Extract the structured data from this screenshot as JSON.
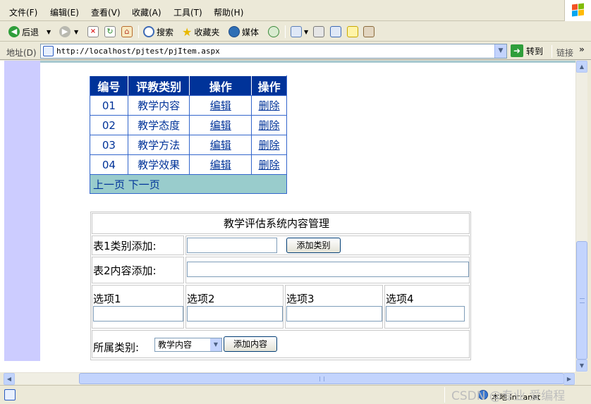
{
  "menu": {
    "items": [
      "文件(F)",
      "编辑(E)",
      "查看(V)",
      "收藏(A)",
      "工具(T)",
      "帮助(H)"
    ]
  },
  "toolbar": {
    "back_label": "后退",
    "search_label": "搜索",
    "favorites_label": "收藏夹",
    "media_label": "媒体"
  },
  "address": {
    "label": "地址(D)",
    "url": "http://localhost/pjtest/pjItem.aspx",
    "go_label": "转到",
    "links_label": "链接",
    "more": "»"
  },
  "grid": {
    "headers": [
      "编号",
      "评教类别",
      "操作",
      "操作"
    ],
    "rows": [
      {
        "id": "01",
        "category": "教学内容",
        "edit": "编辑",
        "delete": "删除"
      },
      {
        "id": "02",
        "category": "教学态度",
        "edit": "编辑",
        "delete": "删除"
      },
      {
        "id": "03",
        "category": "教学方法",
        "edit": "编辑",
        "delete": "删除"
      },
      {
        "id": "04",
        "category": "教学效果",
        "edit": "编辑",
        "delete": "删除"
      }
    ],
    "prev_label": "上一页",
    "next_label": "下一页"
  },
  "mgmt": {
    "title": "教学评估系统内容管理",
    "category_add_label": "表1类别添加:",
    "category_input_value": "",
    "add_category_button": "添加类别",
    "content_add_label": "表2内容添加:",
    "content_input_value": "",
    "option1_label": "选项1",
    "option2_label": "选项2",
    "option3_label": "选项3",
    "option4_label": "选项4",
    "category_select_label": "所属类别:",
    "category_select_value": "教学内容",
    "add_content_button": "添加内容"
  },
  "status": {
    "zone": "本地 Intranet",
    "watermark": "CSDN @专业 爱编程"
  },
  "colors": {
    "grid_header_bg": "#003399",
    "grid_pager_bg": "#99CCCC",
    "grid_text": "#003399",
    "left_strip": "#CCCCFF"
  }
}
